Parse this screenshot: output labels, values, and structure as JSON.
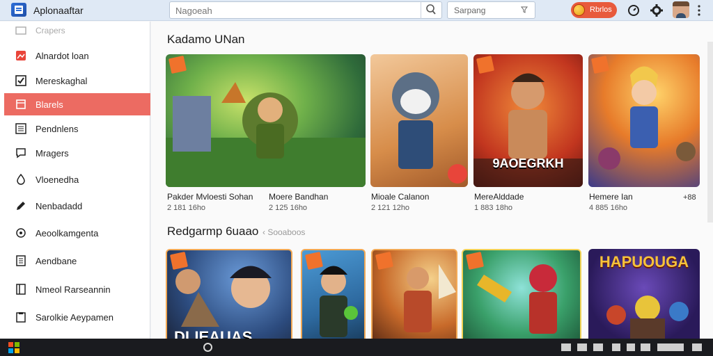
{
  "app": {
    "title": "Aplonaaftar"
  },
  "search": {
    "placeholder": "Nagoeah"
  },
  "filter": {
    "label": "Sarpang"
  },
  "header": {
    "badge_label": "Rbrlos"
  },
  "sidebar": {
    "items": [
      {
        "label": "Crapers",
        "icon": "gallery-icon"
      },
      {
        "label": "Alnardot loan",
        "icon": "image-icon"
      },
      {
        "label": "Mereskaghal",
        "icon": "check-icon"
      },
      {
        "label": "Blarels",
        "icon": "layers-icon"
      },
      {
        "label": "Pendnlens",
        "icon": "list-icon"
      },
      {
        "label": "Mragers",
        "icon": "chat-icon"
      },
      {
        "label": "Vloenedha",
        "icon": "drop-icon"
      },
      {
        "label": "Nenbadadd",
        "icon": "pen-icon"
      },
      {
        "label": "Aeoolkamgenta",
        "icon": "flower-icon"
      },
      {
        "label": "Aendbane",
        "icon": "document-icon"
      },
      {
        "label": "Nmeol Rarseannin",
        "icon": "book-icon"
      },
      {
        "label": "Sarolkie Aeypamen",
        "icon": "clipboard-icon"
      }
    ]
  },
  "sections": [
    {
      "title": "Kadamo UNan",
      "subtitle": "",
      "cards": [
        {
          "title": "Pakder Mvloesti Sohan",
          "meta": "2 181 16ho",
          "banner": ""
        },
        {
          "title": "Moere Bandhan",
          "meta": "2 125 16ho",
          "banner": ""
        },
        {
          "title": "Mioale Calanon",
          "meta": "2 121 12ho",
          "banner": ""
        },
        {
          "title": "MereAlddade",
          "meta": "1 883 18ho",
          "banner": "9AOEGRKH"
        },
        {
          "title": "Hemere Ian",
          "meta": "4 885 16ho",
          "extra": "+88",
          "banner": ""
        }
      ]
    },
    {
      "title": "Redgarmp 6uaao",
      "subtitle": "‹ Sooaboos",
      "cards": [
        {
          "title": "",
          "meta": "",
          "banner": "DLIEAUAS"
        },
        {
          "title": "",
          "meta": "",
          "banner": ""
        },
        {
          "title": "",
          "meta": "",
          "banner": ""
        },
        {
          "title": "",
          "meta": "",
          "banner": ""
        },
        {
          "title": "",
          "meta": "",
          "banner": "HAPUOUGA"
        }
      ]
    }
  ],
  "colors": {
    "accent": "#ec6b62",
    "topbar": "#dfe9f5",
    "badge": "#e85a3c",
    "card_tag": "#f0722c",
    "taskbar": "#1a1b1f"
  }
}
